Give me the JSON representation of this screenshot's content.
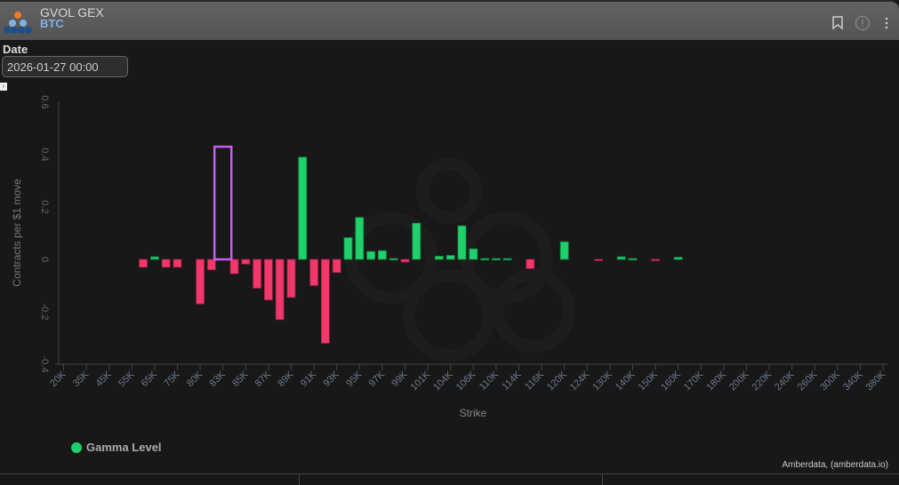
{
  "header": {
    "title": "GVOL GEX",
    "subtitle": "BTC",
    "icons": [
      "bookmark-icon",
      "info-icon",
      "more-icon"
    ]
  },
  "filters": {
    "date_label": "Date",
    "date_value": "2026-01-27 00:00"
  },
  "legend": {
    "label": "Gamma Level"
  },
  "credit": "Amberdata, (amberdata.io)",
  "colors": {
    "positive": "#1fd16a",
    "negative": "#f0386b",
    "highlight": "#c65df0"
  },
  "chart_data": {
    "type": "bar",
    "title": "GVOL GEX",
    "xlabel": "Strike",
    "ylabel": "Contracts per $1 move",
    "ylim": [
      -0.4,
      0.6
    ],
    "yticks": [
      "-0.4",
      "-0.2",
      "0",
      "0.2",
      "0.4",
      "0.6"
    ],
    "ytick_values": [
      -0.4,
      -0.2,
      0,
      0.2,
      0.4,
      0.6
    ],
    "categories": [
      "20K",
      "35K",
      "45K",
      "55K",
      "65K",
      "75K",
      "80K",
      "83K",
      "85K",
      "87K",
      "89K",
      "91K",
      "93K",
      "95K",
      "97K",
      "99K",
      "101K",
      "104K",
      "106K",
      "110K",
      "114K",
      "116K",
      "120K",
      "124K",
      "130K",
      "140K",
      "150K",
      "160K",
      "170K",
      "180K",
      "200K",
      "220K",
      "240K",
      "260K",
      "300K",
      "340K",
      "380K"
    ],
    "series": [
      {
        "name": "Gamma Level",
        "points": [
          {
            "pos": 3.5,
            "value": -0.03
          },
          {
            "pos": 4,
            "value": 0.01
          },
          {
            "pos": 4.5,
            "value": -0.03
          },
          {
            "pos": 5,
            "value": -0.03
          },
          {
            "pos": 6,
            "value": -0.17
          },
          {
            "pos": 6.5,
            "value": -0.04
          },
          {
            "pos": 7.5,
            "value": -0.055
          },
          {
            "pos": 8,
            "value": -0.018
          },
          {
            "pos": 8.5,
            "value": -0.11
          },
          {
            "pos": 9,
            "value": -0.155
          },
          {
            "pos": 9.5,
            "value": -0.23
          },
          {
            "pos": 10,
            "value": -0.145
          },
          {
            "pos": 10.5,
            "value": 0.39
          },
          {
            "pos": 11,
            "value": -0.1
          },
          {
            "pos": 11.5,
            "value": -0.32
          },
          {
            "pos": 12,
            "value": -0.05
          },
          {
            "pos": 12.5,
            "value": 0.083
          },
          {
            "pos": 13,
            "value": 0.16
          },
          {
            "pos": 13.5,
            "value": 0.03
          },
          {
            "pos": 14,
            "value": 0.033
          },
          {
            "pos": 14.5,
            "value": 0.003
          },
          {
            "pos": 15,
            "value": -0.01
          },
          {
            "pos": 15.5,
            "value": 0.138
          },
          {
            "pos": 16.5,
            "value": 0.012
          },
          {
            "pos": 17,
            "value": 0.015
          },
          {
            "pos": 17.5,
            "value": 0.128
          },
          {
            "pos": 18,
            "value": 0.04
          },
          {
            "pos": 18.5,
            "value": 0.003
          },
          {
            "pos": 19,
            "value": 0.003
          },
          {
            "pos": 19.5,
            "value": 0.003
          },
          {
            "pos": 20.5,
            "value": -0.035
          },
          {
            "pos": 22,
            "value": 0.067
          },
          {
            "pos": 23.5,
            "value": -0.003
          },
          {
            "pos": 24.5,
            "value": 0.01
          },
          {
            "pos": 25,
            "value": 0.003
          },
          {
            "pos": 26,
            "value": -0.003
          },
          {
            "pos": 27,
            "value": 0.008
          }
        ]
      }
    ],
    "highlight": {
      "pos": 7,
      "value": 0.43
    },
    "legend_position": "bottom-left"
  }
}
